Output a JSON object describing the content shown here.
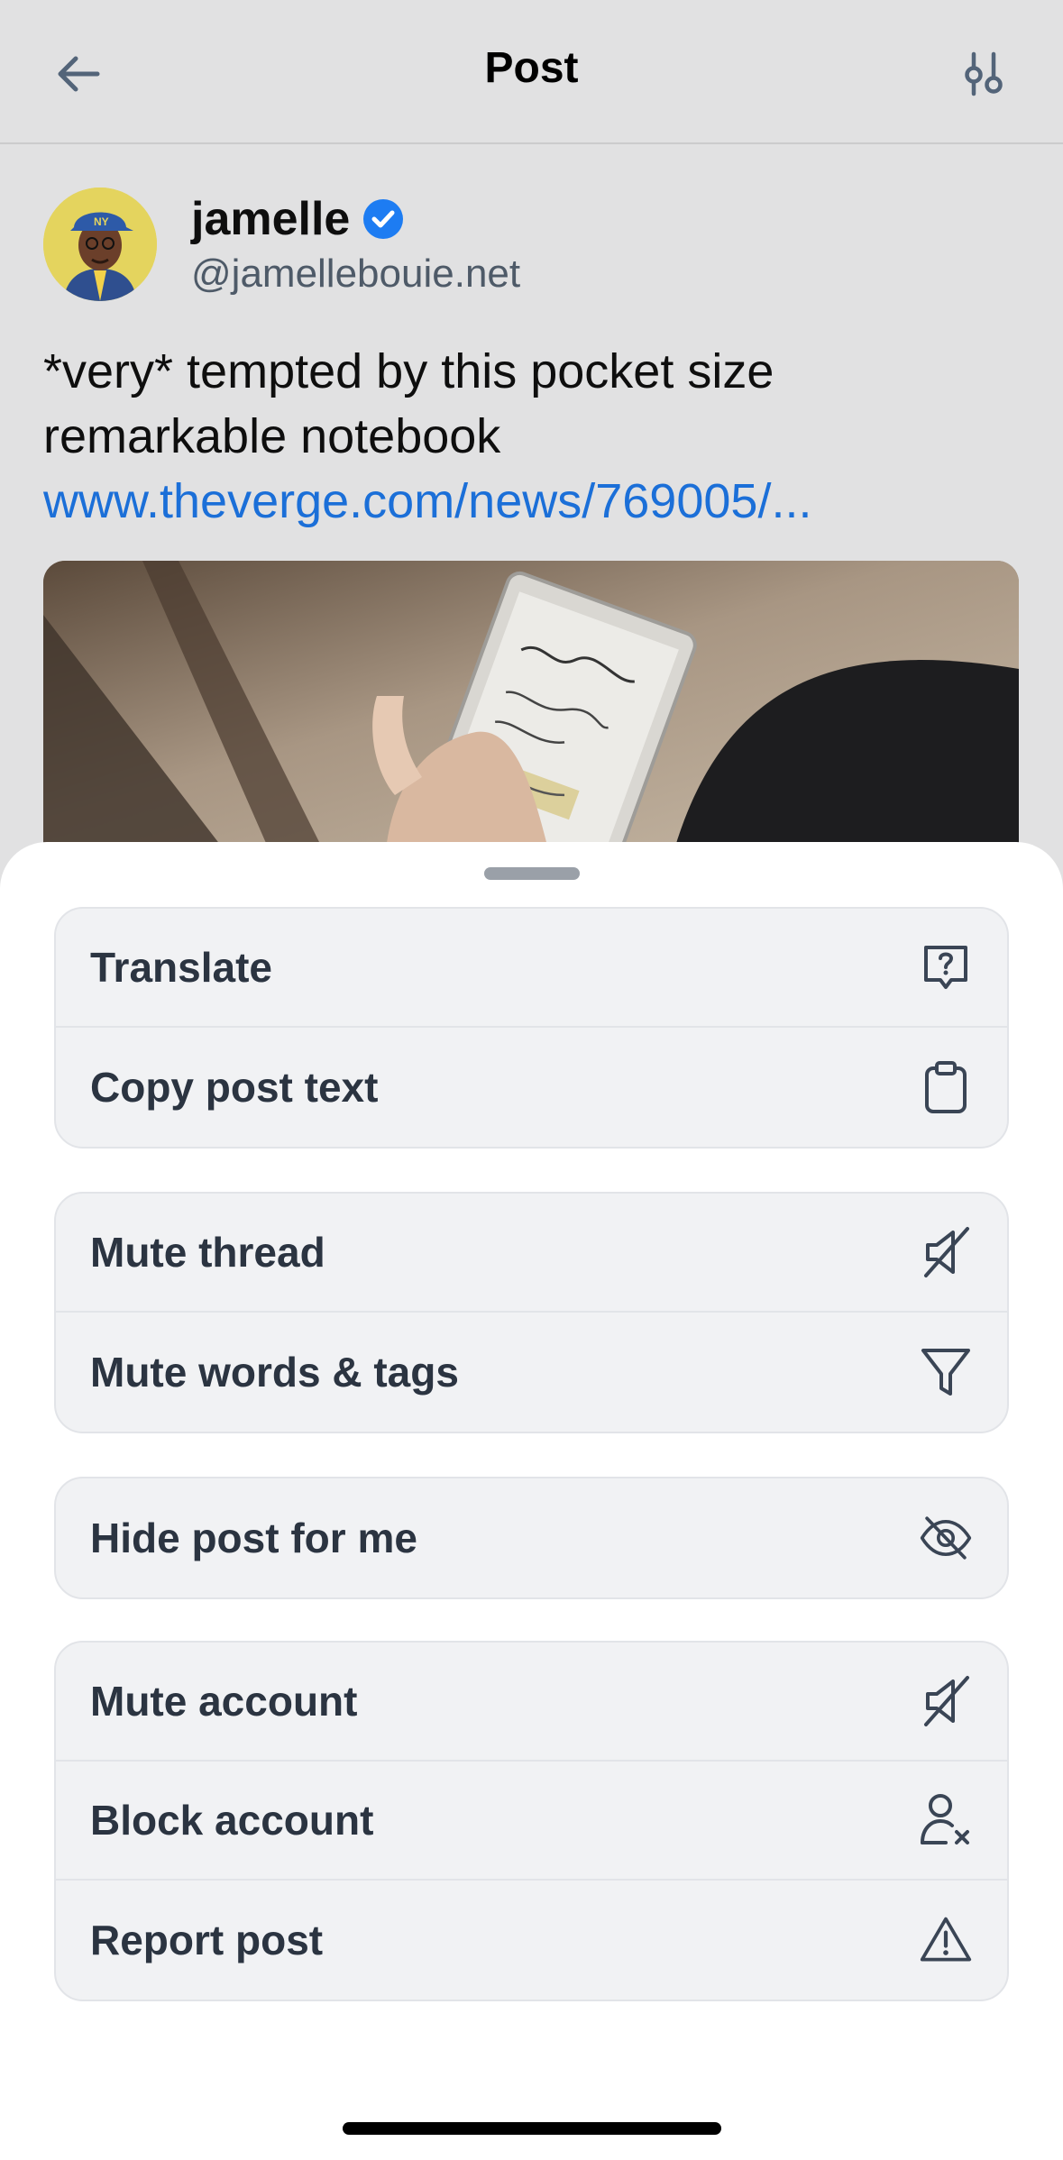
{
  "header": {
    "title": "Post",
    "back_icon": "arrow-left-icon",
    "settings_icon": "sliders-icon"
  },
  "post": {
    "author_name": "jamelle",
    "author_handle": "@jamellebouie.net",
    "text": "*very* tempted by this pocket size remarkable notebook",
    "link": "www.theverge.com/news/769005/..."
  },
  "menu": {
    "group1": [
      {
        "label": "Translate",
        "icon": "translate-bubble-icon"
      },
      {
        "label": "Copy post text",
        "icon": "clipboard-icon"
      }
    ],
    "group2": [
      {
        "label": "Mute thread",
        "icon": "speaker-off-icon"
      },
      {
        "label": "Mute words & tags",
        "icon": "filter-icon"
      }
    ],
    "group3": [
      {
        "label": "Hide post for me",
        "icon": "eye-off-icon"
      }
    ],
    "group4": [
      {
        "label": "Mute account",
        "icon": "speaker-off-icon"
      },
      {
        "label": "Block account",
        "icon": "person-x-icon"
      },
      {
        "label": "Report post",
        "icon": "warning-icon"
      }
    ]
  },
  "colors": {
    "link": "#1b6fd8",
    "verified": "#1d7cf2",
    "menu_text": "#2b3441"
  }
}
